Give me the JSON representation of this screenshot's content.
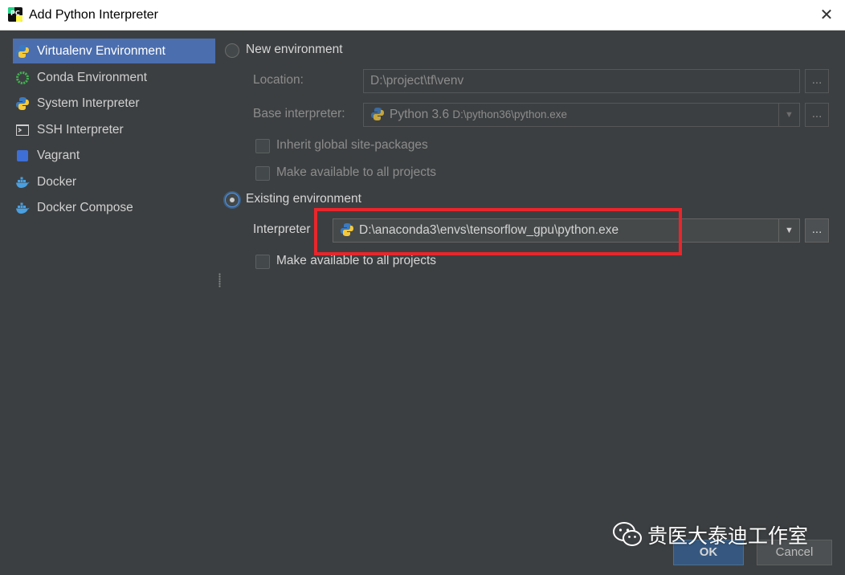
{
  "window": {
    "title": "Add Python Interpreter",
    "close_glyph": "✕",
    "app_icon_text": "PC"
  },
  "sidebar": {
    "items": [
      {
        "label": "Virtualenv Environment",
        "icon": "python-venv-icon",
        "selected": true
      },
      {
        "label": "Conda Environment",
        "icon": "conda-icon"
      },
      {
        "label": "System Interpreter",
        "icon": "python-icon"
      },
      {
        "label": "SSH Interpreter",
        "icon": "terminal-icon"
      },
      {
        "label": "Vagrant",
        "icon": "vagrant-icon"
      },
      {
        "label": "Docker",
        "icon": "docker-icon"
      },
      {
        "label": "Docker Compose",
        "icon": "docker-compose-icon"
      }
    ]
  },
  "new_env": {
    "radio_label": "New environment",
    "location_label": "Location:",
    "location_value": "D:\\project\\tf\\venv",
    "base_label": "Base interpreter:",
    "base_name": "Python 3.6",
    "base_path": "D:\\python36\\python.exe",
    "inherit_label": "Inherit global site-packages",
    "make_available_label": "Make available to all projects",
    "browse": "..."
  },
  "existing_env": {
    "radio_label": "Existing environment",
    "interpreter_label": "Interpreter",
    "interpreter_value": "D:\\anaconda3\\envs\\tensorflow_gpu\\python.exe",
    "make_available_label": "Make available to all projects",
    "browse": "..."
  },
  "dropdown_glyph": "▼",
  "buttons": {
    "ok": "OK",
    "cancel": "Cancel"
  },
  "watermark": {
    "text": "贵医大泰迪工作室"
  },
  "colors": {
    "accent": "#4b6eaf",
    "highlight_box": "#e8262b",
    "background": "#3c3f41"
  }
}
